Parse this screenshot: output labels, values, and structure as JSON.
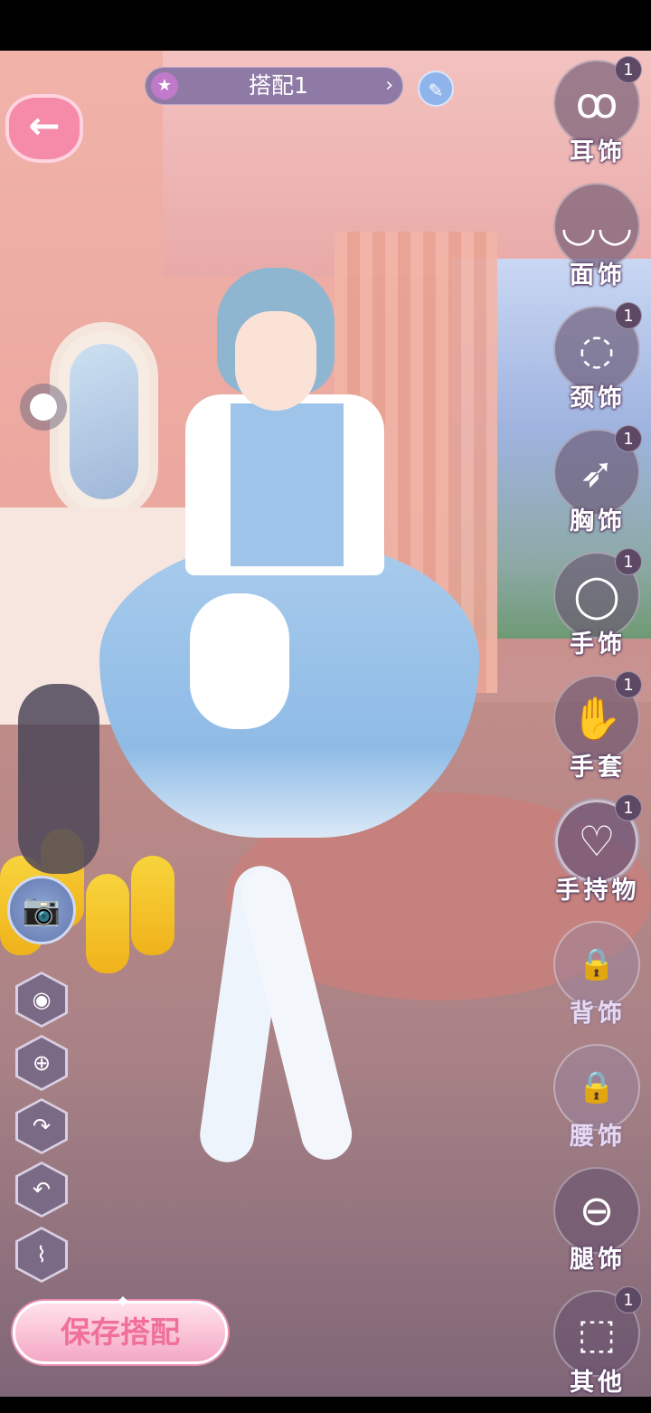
{
  "outfit": {
    "title": "搭配1",
    "prev_icon": "star-icon",
    "next_icon": "chevron-right-icon",
    "edit_icon": "pencil-icon"
  },
  "save_button": {
    "label": "保存搭配"
  },
  "left_tools": [
    "eye-icon",
    "crosshair-icon",
    "redo-icon",
    "undo-icon",
    "broom-icon"
  ],
  "categories": [
    {
      "id": "earrings",
      "label": "耳饰",
      "count": "1",
      "icon": "earring-icon",
      "glyph": "ꝏ",
      "locked": false,
      "active": false
    },
    {
      "id": "mask",
      "label": "面饰",
      "count": "",
      "icon": "mask-icon",
      "glyph": "◡◡",
      "locked": false,
      "active": false
    },
    {
      "id": "necklace",
      "label": "颈饰",
      "count": "1",
      "icon": "necklace-icon",
      "glyph": "◌",
      "locked": false,
      "active": false
    },
    {
      "id": "brooch",
      "label": "胸饰",
      "count": "1",
      "icon": "wing-brooch-icon",
      "glyph": "➶",
      "locked": false,
      "active": false
    },
    {
      "id": "bracelet",
      "label": "手饰",
      "count": "1",
      "icon": "bracelet-icon",
      "glyph": "◯",
      "locked": false,
      "active": false
    },
    {
      "id": "gloves",
      "label": "手套",
      "count": "1",
      "icon": "gloves-icon",
      "glyph": "✋",
      "locked": false,
      "active": false
    },
    {
      "id": "handheld",
      "label": "手持物",
      "count": "1",
      "icon": "handbag-icon",
      "glyph": "♡",
      "locked": false,
      "active": true
    },
    {
      "id": "back",
      "label": "背饰",
      "count": "",
      "icon": "lock-icon",
      "glyph": "🔒",
      "locked": true,
      "active": false
    },
    {
      "id": "waist",
      "label": "腰饰",
      "count": "",
      "icon": "lock-icon",
      "glyph": "🔒",
      "locked": true,
      "active": false
    },
    {
      "id": "leg",
      "label": "腿饰",
      "count": "",
      "icon": "leg-ring-icon",
      "glyph": "⊖",
      "locked": false,
      "active": false
    },
    {
      "id": "other",
      "label": "其他",
      "count": "1",
      "icon": "cube-icon",
      "glyph": "⬚",
      "locked": false,
      "active": false
    }
  ],
  "colors": {
    "accent_pink": "#f06f9b",
    "panel_purple": "#67526e"
  }
}
